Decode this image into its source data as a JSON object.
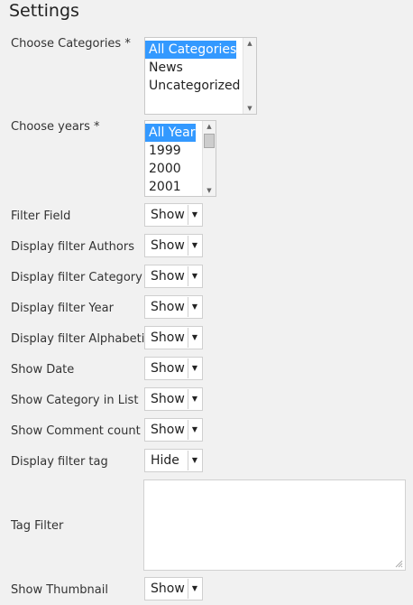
{
  "page": {
    "title": "Settings"
  },
  "categories": {
    "label": "Choose Categories *",
    "options": [
      "All Categories",
      "News",
      "Uncategorized"
    ],
    "selected": "All Categories"
  },
  "years": {
    "label": "Choose years *",
    "options": [
      "All Year",
      "1999",
      "2000",
      "2001"
    ],
    "selected": "All Year"
  },
  "filters": [
    {
      "label": "Filter Field",
      "value": "Show"
    },
    {
      "label": "Display filter Authors",
      "value": "Show"
    },
    {
      "label": "Display filter Category",
      "value": "Show"
    },
    {
      "label": "Display filter Year",
      "value": "Show"
    },
    {
      "label": "Display filter Alphabetic",
      "value": "Show"
    },
    {
      "label": "Show Date",
      "value": "Show"
    },
    {
      "label": "Show Category in List",
      "value": "Show"
    },
    {
      "label": "Show Comment count",
      "value": "Show"
    },
    {
      "label": "Display filter tag",
      "value": "Hide"
    }
  ],
  "tag_filter": {
    "label": "Tag Filter",
    "value": ""
  },
  "thumbnail": {
    "label": "Show Thumbnail",
    "value": "Show"
  },
  "icons": {
    "dropdown_arrow": "chevron-down-icon",
    "scroll_up": "chevron-up-icon",
    "scroll_down": "chevron-down-icon",
    "resize": "resize-grip-icon"
  },
  "colors": {
    "background": "#f1f1f1",
    "selection": "#3399ff",
    "border": "#cfcfcf"
  }
}
